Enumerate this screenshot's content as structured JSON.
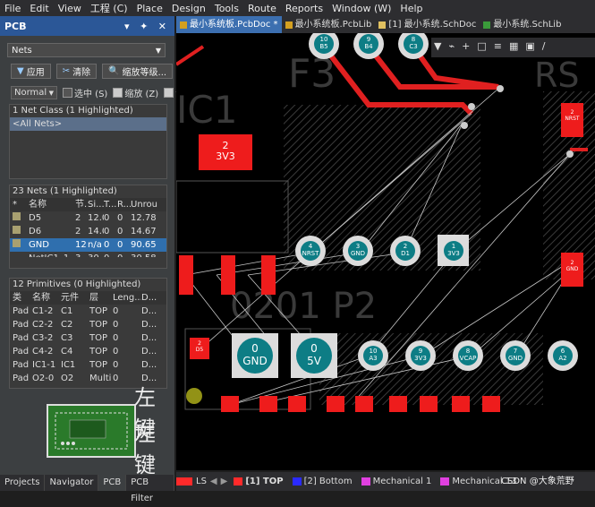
{
  "menu": [
    "File",
    "Edit",
    "View",
    "工程 (C)",
    "Place",
    "Design",
    "Tools",
    "Route",
    "Reports",
    "Window (W)",
    "Help"
  ],
  "panel": {
    "title": "PCB",
    "controls": "▾ ✦ ✕",
    "filter_select": "Nets",
    "buttons": [
      "应用",
      "清除",
      "缩放等级..."
    ],
    "mode_select": "Normal",
    "options": [
      {
        "label": "选中 (S)",
        "checked": false
      },
      {
        "label": "缩放 (Z)",
        "checked": true
      },
      {
        "label": "清",
        "checked": true
      }
    ],
    "net_class_header": "1 Net Class (1 Highlighted)",
    "net_class_item": "<All Nets>",
    "nets_header": "23 Nets (1 Highlighted)",
    "nets_cols": [
      "*",
      "名称",
      "节...",
      "Si...",
      "T...",
      "R...",
      "Unrou"
    ],
    "nets": [
      [
        "",
        "D5",
        "2",
        "12.0",
        "0",
        "0",
        "12.78"
      ],
      [
        "",
        "D6",
        "2",
        "14.0",
        "0",
        "0",
        "14.67"
      ],
      [
        "",
        "GND",
        "12",
        "n/a",
        "0",
        "0",
        "90.65"
      ],
      [
        "",
        "NetIC1_1",
        "3",
        "30",
        "0",
        "0",
        "30.58"
      ]
    ],
    "prims_header": "12 Primitives (0 Highlighted)",
    "prims_cols": [
      "类",
      "名称",
      "元件",
      "层",
      "Leng...",
      "D..."
    ],
    "prims": [
      [
        "Pad",
        "C1-2",
        "C1",
        "TOP",
        "0",
        "D..."
      ],
      [
        "Pad",
        "C2-2",
        "C2",
        "TOP",
        "0",
        "D..."
      ],
      [
        "Pad",
        "C3-2",
        "C3",
        "TOP",
        "0",
        "D..."
      ],
      [
        "Pad",
        "C4-2",
        "C4",
        "TOP",
        "0",
        "D..."
      ],
      [
        "Pad",
        "IC1-1",
        "IC1",
        "TOP",
        "0",
        "D..."
      ],
      [
        "Pad",
        "O2-0",
        "O2",
        "Multi",
        "0",
        "D..."
      ]
    ],
    "bottom_tabs": [
      "Projects",
      "Navigator",
      "PCB",
      "PCB Filter"
    ],
    "overlay_label_1": "左键",
    "overlay_label_2": "左键"
  },
  "doc_tabs": [
    {
      "label": "最小系统板.PcbDoc *",
      "active": true
    },
    {
      "label": "最小系统板.PcbLib",
      "active": false
    },
    {
      "label": "[1] 最小系统.SchDoc",
      "active": false
    },
    {
      "label": "最小系统.SchLib",
      "active": false
    }
  ],
  "canvas": {
    "silk_texts": [
      "IC1",
      "F3",
      "0201 P2",
      "RS"
    ],
    "big_pads": [
      {
        "num": "2",
        "net": "3V3"
      },
      {
        "num": "0",
        "net": "GND"
      },
      {
        "num": "0",
        "net": "5V"
      }
    ],
    "round_pads_top": [
      {
        "num": "10",
        "net": "B5"
      },
      {
        "num": "9",
        "net": "B4"
      },
      {
        "num": "8",
        "net": "C3"
      }
    ],
    "round_pads_mid": [
      {
        "num": "4",
        "net": "NRST"
      },
      {
        "num": "3",
        "net": "GND"
      },
      {
        "num": "2",
        "net": "D1"
      },
      {
        "num": "1",
        "net": "3V3"
      }
    ],
    "round_pads_low": [
      {
        "num": "10",
        "net": "A3"
      },
      {
        "num": "9",
        "net": "3V3"
      },
      {
        "num": "8",
        "net": "VCAP"
      },
      {
        "num": "7",
        "net": "GND"
      },
      {
        "num": "6",
        "net": "A2"
      }
    ],
    "small_pads": [
      {
        "num": "2",
        "net": "D5"
      },
      {
        "num": "2",
        "net": "NRST"
      },
      {
        "num": "2",
        "net": "GND"
      }
    ]
  },
  "status": {
    "ls": "LS",
    "layers": [
      {
        "label": "[1] TOP",
        "color": "#ff2a2a",
        "bold": true
      },
      {
        "label": "[2] Bottom",
        "color": "#2a2aff",
        "bold": false
      },
      {
        "label": "Mechanical 1",
        "color": "#e040e0",
        "bold": false
      },
      {
        "label": "Mechanical 13",
        "color": "#e040e0",
        "bold": false
      }
    ],
    "watermark": "CSDN @大象荒野"
  }
}
